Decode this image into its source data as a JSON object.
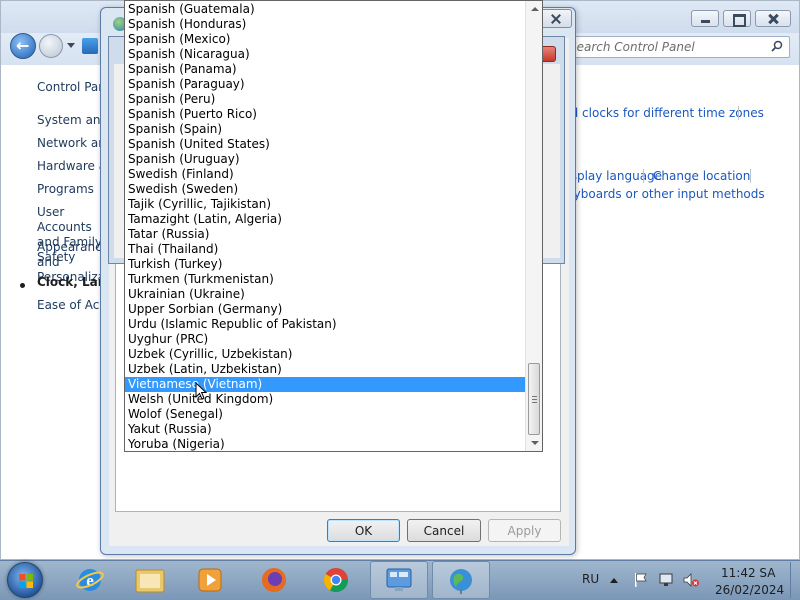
{
  "control_panel": {
    "search_placeholder": "Search Control Panel",
    "sidebar": {
      "home": "Control Panel Home",
      "items": [
        "System and Security",
        "Network and Internet",
        "Hardware and Sound",
        "Programs",
        "User Accounts and Family Safety",
        "Appearance and Personalization",
        "Clock, Language, and Region",
        "Ease of Access"
      ]
    },
    "links": {
      "clocks_time_zones": "Add clocks for different time zones",
      "display_language": "Change display language",
      "change_location": "Change location",
      "keyboards": "Change keyboards or other input methods"
    }
  },
  "dialog": {
    "ok": "OK",
    "cancel": "Cancel",
    "apply": "Apply"
  },
  "dropdown": {
    "items": [
      "Spanish (Guatemala)",
      "Spanish (Honduras)",
      "Spanish (Mexico)",
      "Spanish (Nicaragua)",
      "Spanish (Panama)",
      "Spanish (Paraguay)",
      "Spanish (Peru)",
      "Spanish (Puerto Rico)",
      "Spanish (Spain)",
      "Spanish (United States)",
      "Spanish (Uruguay)",
      "Swedish (Finland)",
      "Swedish (Sweden)",
      "Tajik (Cyrillic, Tajikistan)",
      "Tamazight (Latin, Algeria)",
      "Tatar (Russia)",
      "Thai (Thailand)",
      "Turkish (Turkey)",
      "Turkmen (Turkmenistan)",
      "Ukrainian (Ukraine)",
      "Upper Sorbian (Germany)",
      "Urdu (Islamic Republic of Pakistan)",
      "Uyghur (PRC)",
      "Uzbek (Cyrillic, Uzbekistan)",
      "Uzbek (Latin, Uzbekistan)",
      "Vietnamese (Vietnam)",
      "Welsh (United Kingdom)",
      "Wolof (Senegal)",
      "Yakut (Russia)",
      "Yoruba (Nigeria)"
    ],
    "selected": "Vietnamese (Vietnam)",
    "scroll_position": 0.98,
    "selection_color": "#3399ff"
  },
  "taskbar": {
    "pinned": [
      "start-orb-icon",
      "internet-explorer-icon",
      "windows-explorer-icon",
      "media-player-icon",
      "firefox-icon",
      "chrome-icon",
      "control-panel-icon",
      "region-language-icon"
    ],
    "language": "RU",
    "time": "11:42 SA",
    "date": "26/02/2024"
  }
}
